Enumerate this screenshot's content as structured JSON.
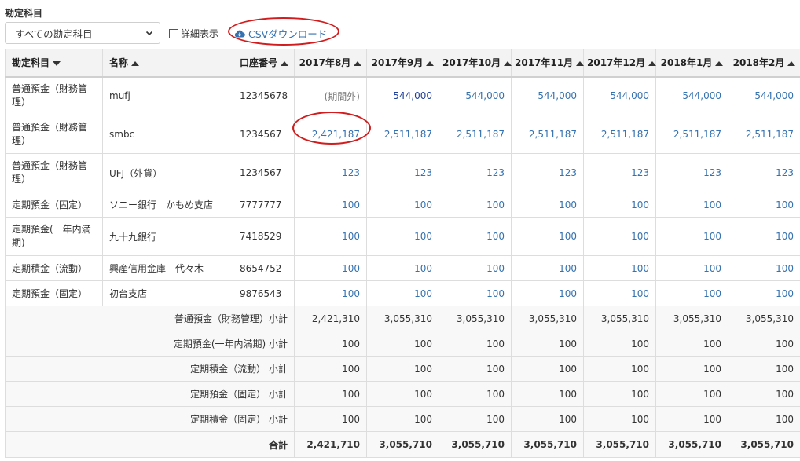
{
  "filter": {
    "label": "勘定科目",
    "selected": "すべての勘定科目",
    "detail_label": "詳細表示",
    "detail_checked": false,
    "csv_label": "CSVダウンロード"
  },
  "columns": {
    "account": "勘定科目",
    "name": "名称",
    "number": "口座番号",
    "months": [
      "2017年8月",
      "2017年9月",
      "2017年10月",
      "2017年11月",
      "2017年12月",
      "2018年1月",
      "2018年2月"
    ]
  },
  "rows": [
    {
      "account": "普通預金（財務管理）",
      "name": "mufj",
      "number": "12345678",
      "values": [
        "(期間外)",
        "544,000",
        "544,000",
        "544,000",
        "544,000",
        "544,000",
        "544,000"
      ]
    },
    {
      "account": "普通預金（財務管理）",
      "name": "smbc",
      "number": "1234567",
      "values": [
        "2,421,187",
        "2,511,187",
        "2,511,187",
        "2,511,187",
        "2,511,187",
        "2,511,187",
        "2,511,187"
      ]
    },
    {
      "account": "普通預金（財務管理）",
      "name": "UFJ（外貨）",
      "number": "1234567",
      "values": [
        "123",
        "123",
        "123",
        "123",
        "123",
        "123",
        "123"
      ]
    },
    {
      "account": "定期預金（固定）",
      "name": "ソニー銀行　かもめ支店",
      "number": "7777777",
      "values": [
        "100",
        "100",
        "100",
        "100",
        "100",
        "100",
        "100"
      ]
    },
    {
      "account": "定期預金(一年内満期)",
      "name": "九十九銀行",
      "number": "7418529",
      "values": [
        "100",
        "100",
        "100",
        "100",
        "100",
        "100",
        "100"
      ]
    },
    {
      "account": "定期積金（流動）",
      "name": "興産信用金庫　代々木",
      "number": "8654752",
      "values": [
        "100",
        "100",
        "100",
        "100",
        "100",
        "100",
        "100"
      ]
    },
    {
      "account": "定期預金（固定）",
      "name": "初台支店",
      "number": "9876543",
      "values": [
        "100",
        "100",
        "100",
        "100",
        "100",
        "100",
        "100"
      ]
    }
  ],
  "subtotals": [
    {
      "label": "普通預金（財務管理）小計",
      "values": [
        "2,421,310",
        "3,055,310",
        "3,055,310",
        "3,055,310",
        "3,055,310",
        "3,055,310",
        "3,055,310"
      ]
    },
    {
      "label": "定期預金(一年内満期) 小計",
      "values": [
        "100",
        "100",
        "100",
        "100",
        "100",
        "100",
        "100"
      ]
    },
    {
      "label": "定期積金（流動） 小計",
      "values": [
        "100",
        "100",
        "100",
        "100",
        "100",
        "100",
        "100"
      ]
    },
    {
      "label": "定期預金（固定） 小計",
      "values": [
        "100",
        "100",
        "100",
        "100",
        "100",
        "100",
        "100"
      ]
    },
    {
      "label": "定期積金（固定） 小計",
      "values": [
        "100",
        "100",
        "100",
        "100",
        "100",
        "100",
        "100"
      ]
    }
  ],
  "total": {
    "label": "合計",
    "values": [
      "2,421,710",
      "3,055,710",
      "3,055,710",
      "3,055,710",
      "3,055,710",
      "3,055,710",
      "3,055,710"
    ]
  },
  "colors": {
    "link": "#3572b0",
    "dark_link": "#1f3f9b",
    "highlight": "#d11d1d",
    "header_bg": "#f3f3f3",
    "subtotal_bg": "#f8f8f8"
  },
  "icons": {
    "select": "chevron-down-icon",
    "csv": "cloud-download-icon"
  }
}
